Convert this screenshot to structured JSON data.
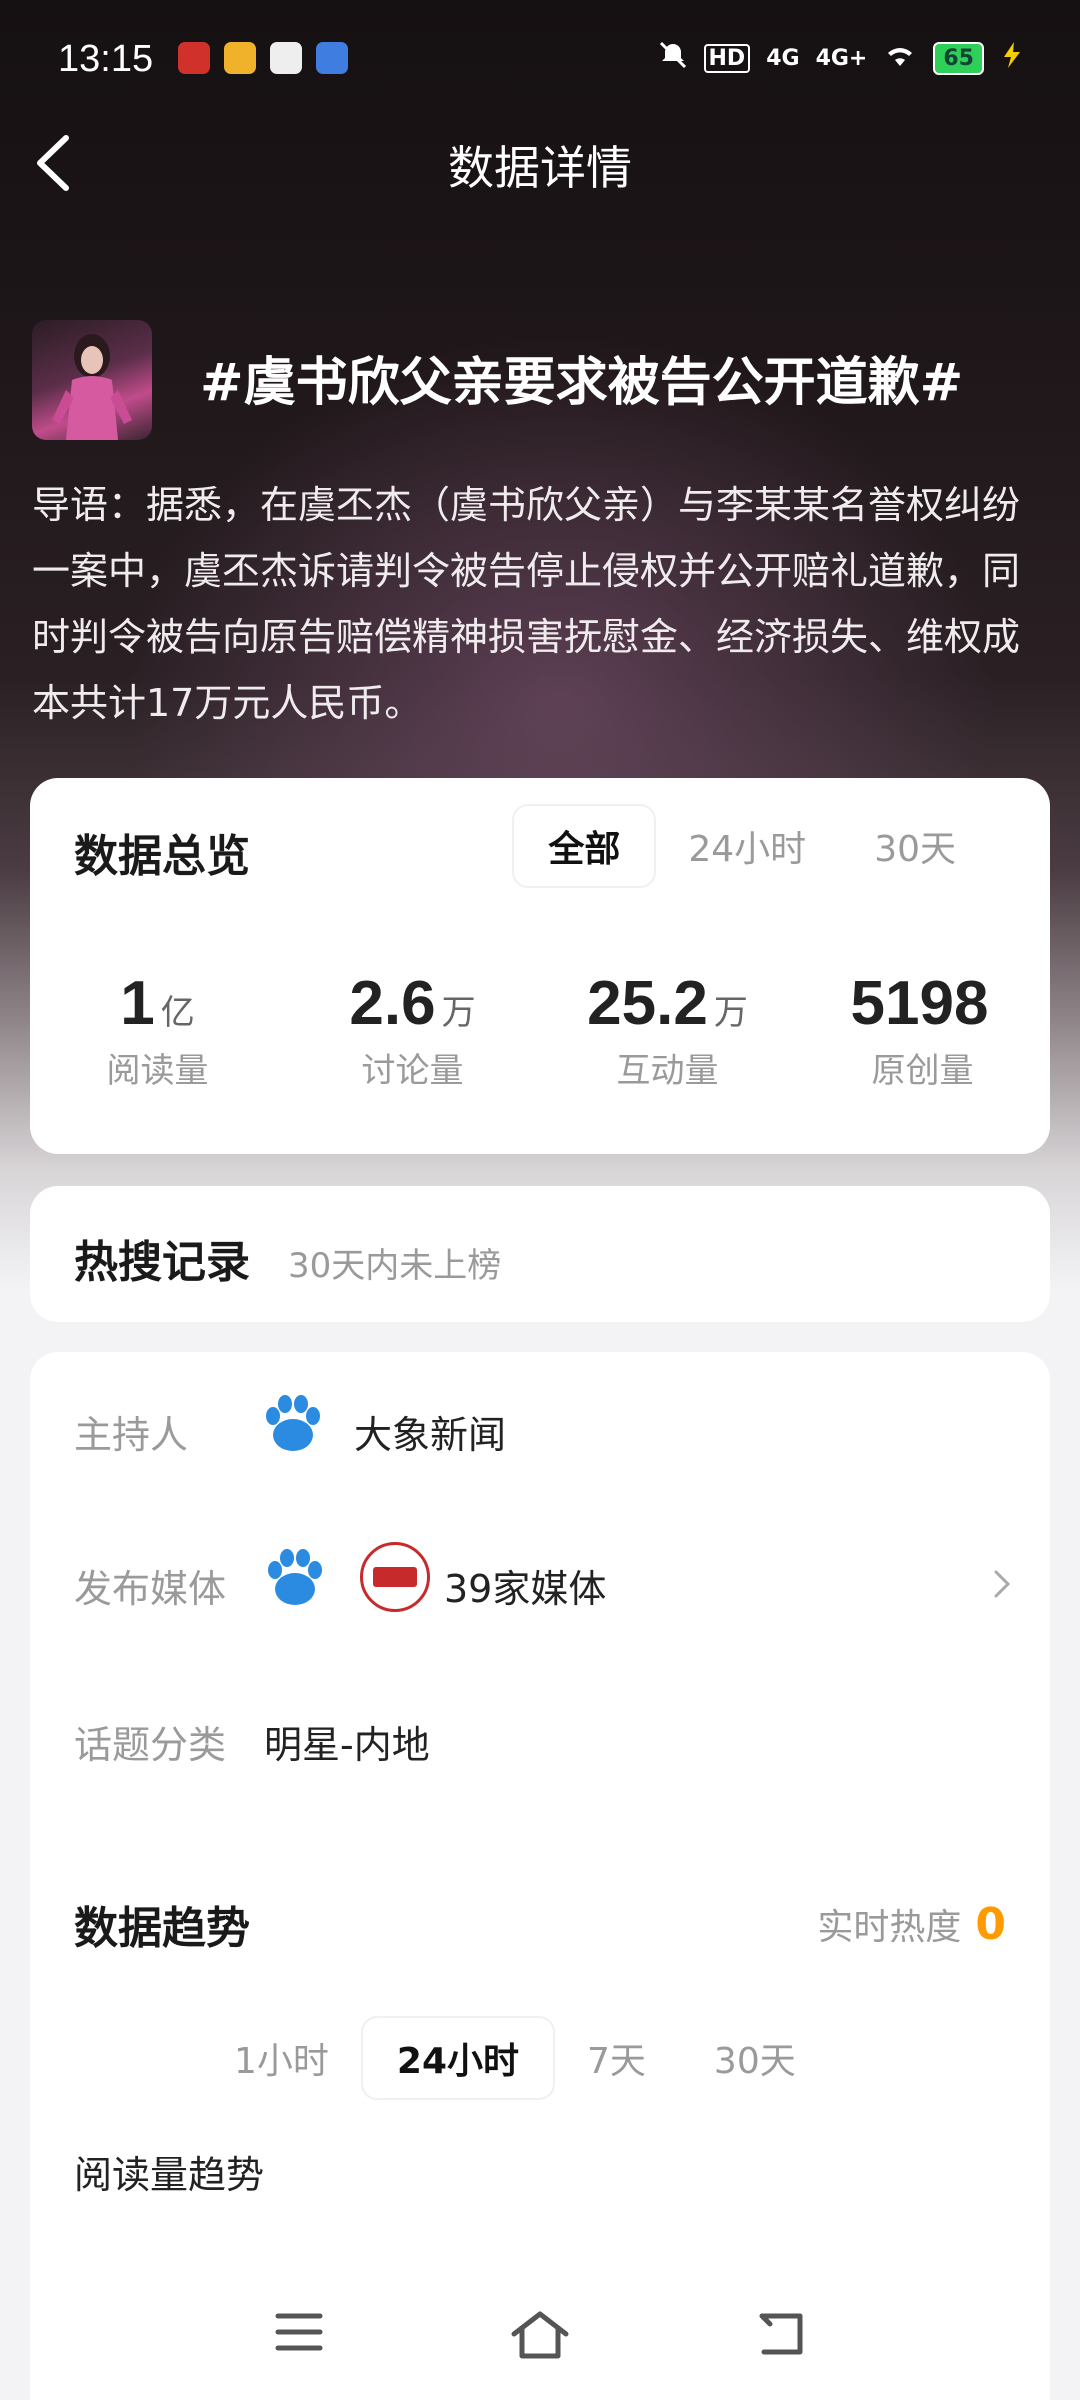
{
  "status_bar": {
    "time": "13:15",
    "battery": "65",
    "network_a": "4G",
    "network_b": "4G+",
    "hd": "HD"
  },
  "nav": {
    "title": "数据详情"
  },
  "topic": {
    "title": "#虞书欣父亲要求被告公开道歉#",
    "intro": "导语：据悉，在虞丕杰（虞书欣父亲）与李某某名誉权纠纷一案中，虞丕杰诉请判令被告停止侵权并公开赔礼道歉，同时判令被告向原告赔偿精神损害抚慰金、经济损失、维权成本共计17万元人民币。"
  },
  "overview": {
    "title": "数据总览",
    "tabs": [
      "全部",
      "24小时",
      "30天"
    ],
    "active_tab": "全部",
    "stats": [
      {
        "value": "1",
        "unit": "亿",
        "label": "阅读量"
      },
      {
        "value": "2.6",
        "unit": "万",
        "label": "讨论量"
      },
      {
        "value": "25.2",
        "unit": "万",
        "label": "互动量"
      },
      {
        "value": "5198",
        "unit": "",
        "label": "原创量"
      }
    ]
  },
  "hot_search": {
    "title": "热搜记录",
    "subtitle": "30天内未上榜"
  },
  "info": {
    "host_label": "主持人",
    "host_value": "大象新闻",
    "media_label": "发布媒体",
    "media_value": "39家媒体",
    "category_label": "话题分类",
    "category_value": "明星-内地"
  },
  "trend": {
    "title": "数据趋势",
    "realtime_label": "实时热度",
    "realtime_value": "0",
    "tabs": [
      "1小时",
      "24小时",
      "7天",
      "30天"
    ],
    "active_tab": "24小时",
    "read_trend_label": "阅读量趋势"
  },
  "colors": {
    "accent": "#ff9a00",
    "paw_blue": "#2a8be0"
  }
}
